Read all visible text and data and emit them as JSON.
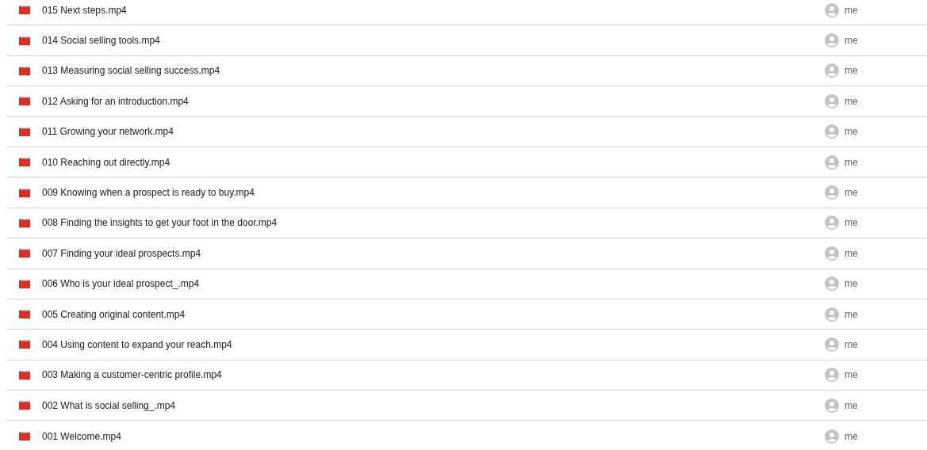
{
  "files": [
    {
      "name": "015 Next steps.mp4",
      "owner": "me"
    },
    {
      "name": "014 Social selling tools.mp4",
      "owner": "me"
    },
    {
      "name": "013 Measuring social selling success.mp4",
      "owner": "me"
    },
    {
      "name": "012 Asking for an introduction.mp4",
      "owner": "me"
    },
    {
      "name": "011 Growing your network.mp4",
      "owner": "me"
    },
    {
      "name": "010 Reaching out directly.mp4",
      "owner": "me"
    },
    {
      "name": "009 Knowing when a prospect is ready to buy.mp4",
      "owner": "me"
    },
    {
      "name": "008 Finding the insights to get your foot in the door.mp4",
      "owner": "me"
    },
    {
      "name": "007 Finding your ideal prospects.mp4",
      "owner": "me"
    },
    {
      "name": "006 Who is your ideal prospect_.mp4",
      "owner": "me"
    },
    {
      "name": "005 Creating original content.mp4",
      "owner": "me"
    },
    {
      "name": "004 Using content to expand your reach.mp4",
      "owner": "me"
    },
    {
      "name": "003 Making a customer-centric profile.mp4",
      "owner": "me"
    },
    {
      "name": "002 What is social selling_.mp4",
      "owner": "me"
    },
    {
      "name": "001 Welcome.mp4",
      "owner": "me"
    }
  ]
}
